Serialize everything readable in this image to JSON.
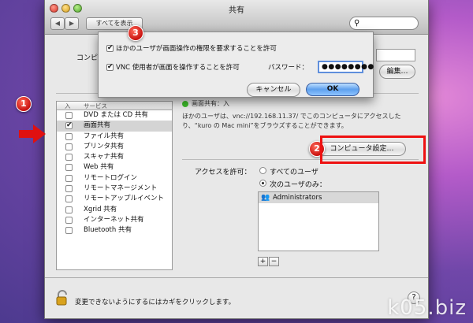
{
  "window": {
    "title": "共有",
    "show_all_label": "すべてを表示",
    "back_glyph": "◀",
    "forward_glyph": "▶",
    "search_icon": "magnifier-icon",
    "computer_name_label": "コンピュ",
    "edit_button_label": "編集…"
  },
  "sheet": {
    "option1_label": "ほかのユーザが画面操作の権限を要求することを許可",
    "option2_label": "VNC 使用者が画面を操作することを許可",
    "password_label": "パスワード：",
    "password_value": "●●●●●●●●",
    "cancel_label": "キャンセル",
    "ok_label": "OK"
  },
  "services": {
    "header_on": "入",
    "header_service": "サービス",
    "items": [
      {
        "label": "DVD または CD 共有",
        "checked": false,
        "selected": false
      },
      {
        "label": "画面共有",
        "checked": true,
        "selected": true
      },
      {
        "label": "ファイル共有",
        "checked": false,
        "selected": false
      },
      {
        "label": "プリンタ共有",
        "checked": false,
        "selected": false
      },
      {
        "label": "スキャナ共有",
        "checked": false,
        "selected": false
      },
      {
        "label": "Web 共有",
        "checked": false,
        "selected": false
      },
      {
        "label": "リモートログイン",
        "checked": false,
        "selected": false
      },
      {
        "label": "リモートマネージメント",
        "checked": false,
        "selected": false
      },
      {
        "label": "リモートアップルイベント",
        "checked": false,
        "selected": false
      },
      {
        "label": "Xgrid 共有",
        "checked": false,
        "selected": false
      },
      {
        "label": "インターネット共有",
        "checked": false,
        "selected": false
      },
      {
        "label": "Bluetooth 共有",
        "checked": false,
        "selected": false
      }
    ]
  },
  "detail": {
    "status_label": "画面共有：入",
    "description_line1": "ほかのユーザは、vnc://192.168.11.37/ でこのコンピュータにアクセスした",
    "description_line2": "り、“kuro の Mac mini”をブラウズすることができます。",
    "computer_settings_label": "コンピュータ設定…",
    "access_label": "アクセスを許可：",
    "radio_all_users": "すべてのユーザ",
    "radio_only_users": "次のユーザのみ：",
    "selected_radio": "only",
    "users": [
      "Administrators"
    ],
    "add_glyph": "+",
    "remove_glyph": "−"
  },
  "footer": {
    "lock_text": "変更できないようにするにはカギをクリックします。",
    "help_glyph": "?"
  },
  "annotations": {
    "badge1": "1",
    "badge2": "2",
    "badge3": "3",
    "accent_color": "#e01010"
  },
  "watermark": "k05.biz"
}
